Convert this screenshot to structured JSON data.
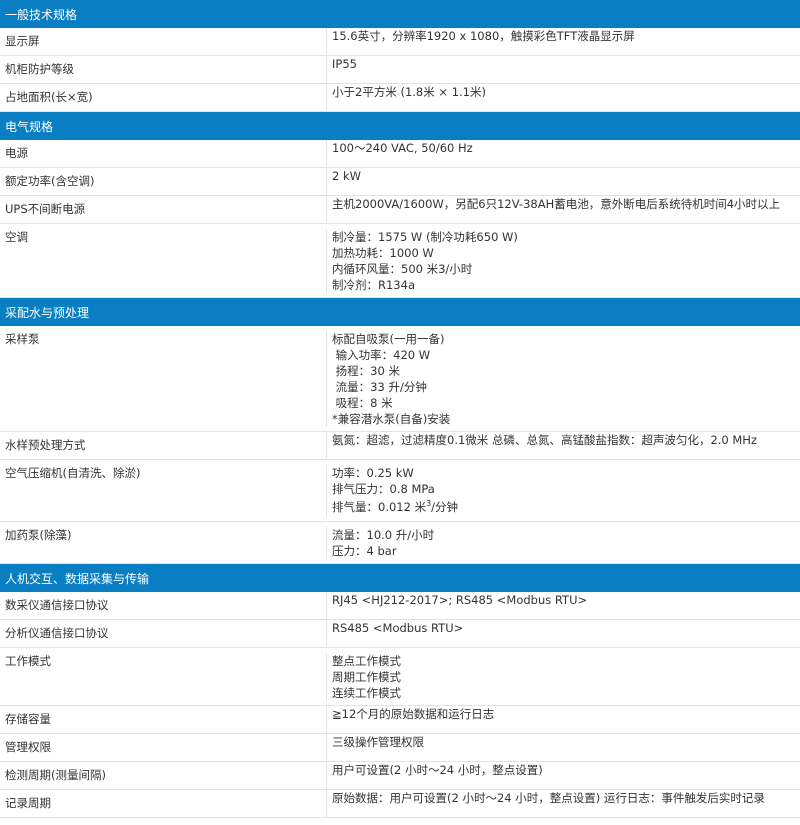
{
  "sections": [
    {
      "title": "一般技术规格",
      "rows": [
        {
          "label": "显示屏",
          "lines": [
            "15.6英寸，分辨率1920 x 1080，触摸彩色TFT液晶显示屏"
          ]
        },
        {
          "label": "机柜防护等级",
          "lines": [
            "IP55"
          ]
        },
        {
          "label": "占地面积(长×宽)",
          "lines": [
            "小于2平方米 (1.8米 × 1.1米)"
          ]
        }
      ]
    },
    {
      "title": "电气规格",
      "rows": [
        {
          "label": "电源",
          "lines": [
            "100～240 VAC, 50/60 Hz"
          ]
        },
        {
          "label": "额定功率(含空调)",
          "lines": [
            "2 kW"
          ]
        },
        {
          "label": "UPS不间断电源",
          "lines": [
            "主机2000VA/1600W，另配6只12V-38AH蓄电池，意外断电后系统待机时间4小时以上"
          ]
        },
        {
          "label": "空调",
          "lines": [
            "制冷量：1575 W (制冷功耗650 W)",
            "加热功耗：1000 W",
            "内循环风量：500 米3/小时",
            "制冷剂：R134a"
          ]
        }
      ]
    },
    {
      "title": "采配水与预处理",
      "rows": [
        {
          "label": "采样泵",
          "lines": [
            "标配自吸泵(一用一备)",
            " 输入功率：420 W",
            " 扬程：30 米",
            " 流量：33 升/分钟",
            " 吸程：8 米",
            "*兼容潜水泵(自备)安装"
          ]
        },
        {
          "label": "水样预处理方式",
          "lines": [
            "氨氮：超滤，过滤精度0.1微米 总磷、总氮、高锰酸盐指数：超声波匀化，2.0 MHz"
          ]
        },
        {
          "label": "空气压缩机(自清洗、除淤)",
          "lines": [
            "功率：0.25 kW",
            "排气压力：0.8 MPa"
          ],
          "sup_line": {
            "prefix": "排气量：0.012 米",
            "sup": "3",
            "suffix": "/分钟"
          }
        },
        {
          "label": "加药泵(除藻)",
          "lines": [
            "流量：10.0 升/小时",
            "压力：4 bar"
          ]
        }
      ]
    },
    {
      "title": "人机交互、数据采集与传输",
      "rows": [
        {
          "label": "数采仪通信接口协议",
          "lines": [
            "RJ45 <HJ212-2017>; RS485 <Modbus RTU>"
          ]
        },
        {
          "label": "分析仪通信接口协议",
          "lines": [
            "RS485 <Modbus RTU>"
          ]
        },
        {
          "label": "工作模式",
          "lines": [
            "整点工作模式",
            "周期工作模式",
            "连续工作模式"
          ]
        },
        {
          "label": "存储容量",
          "lines": [
            "≧12个月的原始数据和运行日志"
          ]
        },
        {
          "label": "管理权限",
          "lines": [
            "三级操作管理权限"
          ]
        },
        {
          "label": "检测周期(测量间隔)",
          "lines": [
            "用户可设置(2 小时～24 小时，整点设置)"
          ]
        },
        {
          "label": "记录周期",
          "lines": [
            "原始数据：用户可设置(2 小时～24 小时，整点设置) 运行日志：事件触发后实时记录"
          ]
        }
      ]
    }
  ]
}
